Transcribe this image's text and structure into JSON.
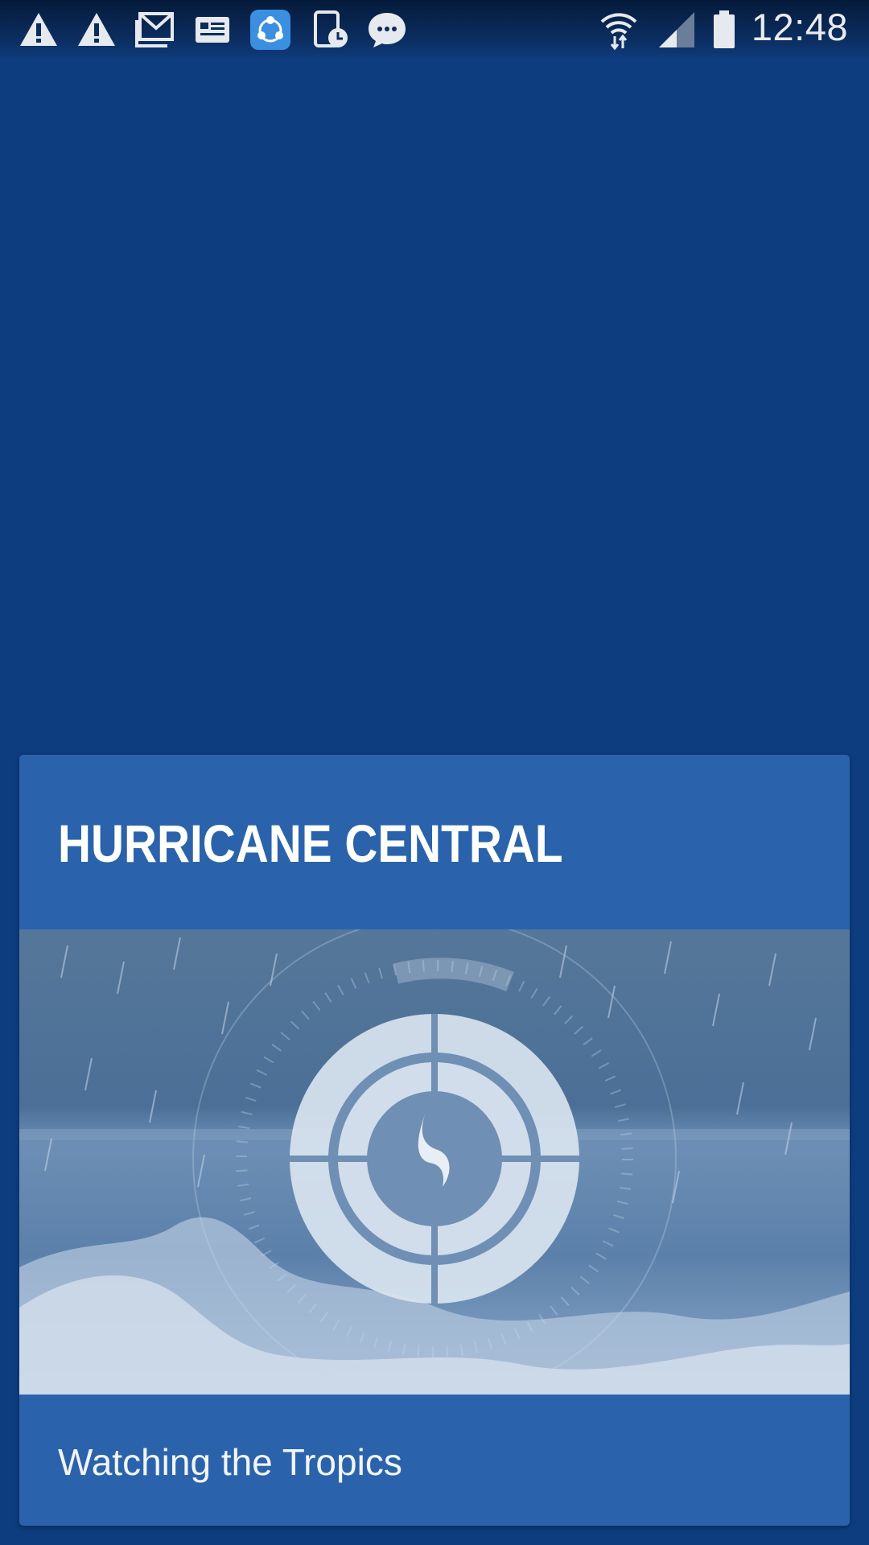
{
  "status_bar": {
    "time": "12:48",
    "notification_icons": [
      "warning-icon",
      "warning-icon",
      "gmail-icon",
      "news-icon",
      "shareit-icon",
      "device-clock-icon",
      "messaging-icon"
    ],
    "system_icons": [
      "wifi-icon",
      "signal-icon",
      "battery-icon"
    ]
  },
  "card": {
    "title": "HURRICANE CENTRAL",
    "subtitle": "Watching the Tropics",
    "image_icon": "hurricane-radar-icon"
  },
  "colors": {
    "background": "#0e3d7f",
    "card": "#2a63ab",
    "image_tint": "#5b7ea8"
  }
}
